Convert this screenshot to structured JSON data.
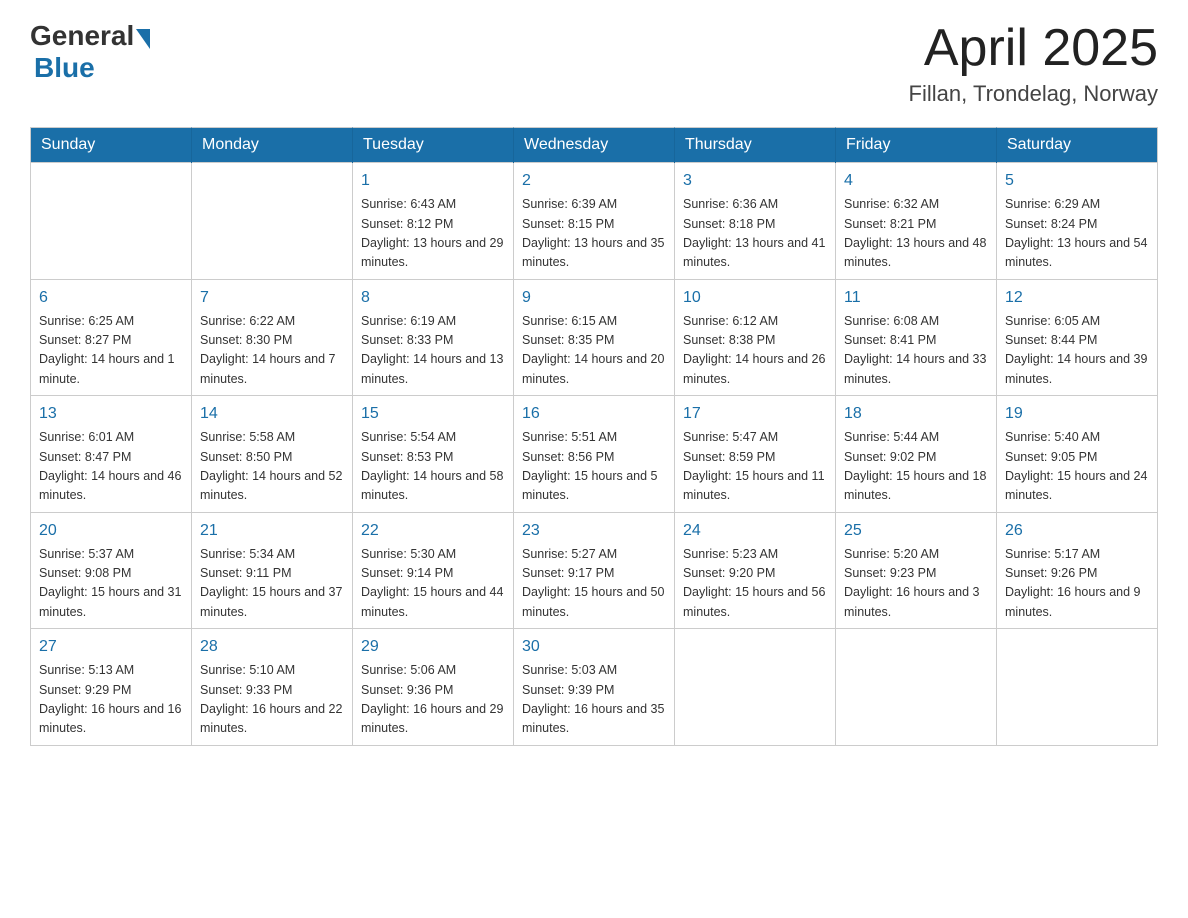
{
  "logo": {
    "general": "General",
    "blue": "Blue"
  },
  "title": "April 2025",
  "subtitle": "Fillan, Trondelag, Norway",
  "weekdays": [
    "Sunday",
    "Monday",
    "Tuesday",
    "Wednesday",
    "Thursday",
    "Friday",
    "Saturday"
  ],
  "weeks": [
    [
      {
        "day": null
      },
      {
        "day": null
      },
      {
        "day": "1",
        "sunrise": "6:43 AM",
        "sunset": "8:12 PM",
        "daylight": "13 hours and 29 minutes."
      },
      {
        "day": "2",
        "sunrise": "6:39 AM",
        "sunset": "8:15 PM",
        "daylight": "13 hours and 35 minutes."
      },
      {
        "day": "3",
        "sunrise": "6:36 AM",
        "sunset": "8:18 PM",
        "daylight": "13 hours and 41 minutes."
      },
      {
        "day": "4",
        "sunrise": "6:32 AM",
        "sunset": "8:21 PM",
        "daylight": "13 hours and 48 minutes."
      },
      {
        "day": "5",
        "sunrise": "6:29 AM",
        "sunset": "8:24 PM",
        "daylight": "13 hours and 54 minutes."
      }
    ],
    [
      {
        "day": "6",
        "sunrise": "6:25 AM",
        "sunset": "8:27 PM",
        "daylight": "14 hours and 1 minute."
      },
      {
        "day": "7",
        "sunrise": "6:22 AM",
        "sunset": "8:30 PM",
        "daylight": "14 hours and 7 minutes."
      },
      {
        "day": "8",
        "sunrise": "6:19 AM",
        "sunset": "8:33 PM",
        "daylight": "14 hours and 13 minutes."
      },
      {
        "day": "9",
        "sunrise": "6:15 AM",
        "sunset": "8:35 PM",
        "daylight": "14 hours and 20 minutes."
      },
      {
        "day": "10",
        "sunrise": "6:12 AM",
        "sunset": "8:38 PM",
        "daylight": "14 hours and 26 minutes."
      },
      {
        "day": "11",
        "sunrise": "6:08 AM",
        "sunset": "8:41 PM",
        "daylight": "14 hours and 33 minutes."
      },
      {
        "day": "12",
        "sunrise": "6:05 AM",
        "sunset": "8:44 PM",
        "daylight": "14 hours and 39 minutes."
      }
    ],
    [
      {
        "day": "13",
        "sunrise": "6:01 AM",
        "sunset": "8:47 PM",
        "daylight": "14 hours and 46 minutes."
      },
      {
        "day": "14",
        "sunrise": "5:58 AM",
        "sunset": "8:50 PM",
        "daylight": "14 hours and 52 minutes."
      },
      {
        "day": "15",
        "sunrise": "5:54 AM",
        "sunset": "8:53 PM",
        "daylight": "14 hours and 58 minutes."
      },
      {
        "day": "16",
        "sunrise": "5:51 AM",
        "sunset": "8:56 PM",
        "daylight": "15 hours and 5 minutes."
      },
      {
        "day": "17",
        "sunrise": "5:47 AM",
        "sunset": "8:59 PM",
        "daylight": "15 hours and 11 minutes."
      },
      {
        "day": "18",
        "sunrise": "5:44 AM",
        "sunset": "9:02 PM",
        "daylight": "15 hours and 18 minutes."
      },
      {
        "day": "19",
        "sunrise": "5:40 AM",
        "sunset": "9:05 PM",
        "daylight": "15 hours and 24 minutes."
      }
    ],
    [
      {
        "day": "20",
        "sunrise": "5:37 AM",
        "sunset": "9:08 PM",
        "daylight": "15 hours and 31 minutes."
      },
      {
        "day": "21",
        "sunrise": "5:34 AM",
        "sunset": "9:11 PM",
        "daylight": "15 hours and 37 minutes."
      },
      {
        "day": "22",
        "sunrise": "5:30 AM",
        "sunset": "9:14 PM",
        "daylight": "15 hours and 44 minutes."
      },
      {
        "day": "23",
        "sunrise": "5:27 AM",
        "sunset": "9:17 PM",
        "daylight": "15 hours and 50 minutes."
      },
      {
        "day": "24",
        "sunrise": "5:23 AM",
        "sunset": "9:20 PM",
        "daylight": "15 hours and 56 minutes."
      },
      {
        "day": "25",
        "sunrise": "5:20 AM",
        "sunset": "9:23 PM",
        "daylight": "16 hours and 3 minutes."
      },
      {
        "day": "26",
        "sunrise": "5:17 AM",
        "sunset": "9:26 PM",
        "daylight": "16 hours and 9 minutes."
      }
    ],
    [
      {
        "day": "27",
        "sunrise": "5:13 AM",
        "sunset": "9:29 PM",
        "daylight": "16 hours and 16 minutes."
      },
      {
        "day": "28",
        "sunrise": "5:10 AM",
        "sunset": "9:33 PM",
        "daylight": "16 hours and 22 minutes."
      },
      {
        "day": "29",
        "sunrise": "5:06 AM",
        "sunset": "9:36 PM",
        "daylight": "16 hours and 29 minutes."
      },
      {
        "day": "30",
        "sunrise": "5:03 AM",
        "sunset": "9:39 PM",
        "daylight": "16 hours and 35 minutes."
      },
      {
        "day": null
      },
      {
        "day": null
      },
      {
        "day": null
      }
    ]
  ]
}
